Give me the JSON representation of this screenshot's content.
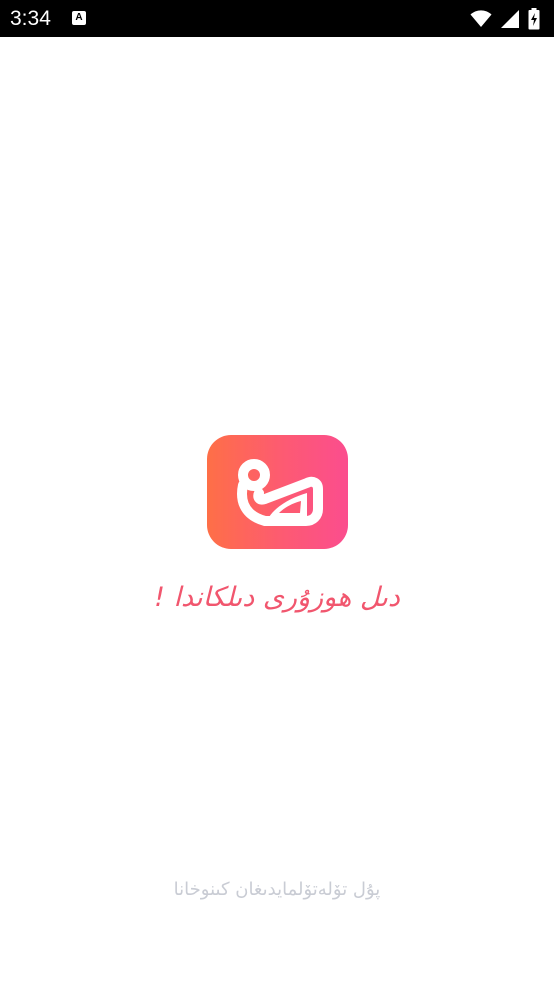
{
  "status_bar": {
    "time": "3:34",
    "notification_icon_letter": "A",
    "icons": [
      "wifi-icon",
      "cell-signal-icon",
      "battery-charging-icon"
    ]
  },
  "splash": {
    "logo_icon": "app-logo-icon",
    "tagline": "دىل ھوزۇرى دىلكاندا !",
    "footer_text": "پۇل تۆلەتۆلمايدىغان كىنوخانا",
    "colors": {
      "logo_gradient_start": "#fe6f47",
      "logo_gradient_end": "#fb4d8e",
      "tagline": "#f1566e",
      "footer": "#c9ccd4"
    }
  }
}
